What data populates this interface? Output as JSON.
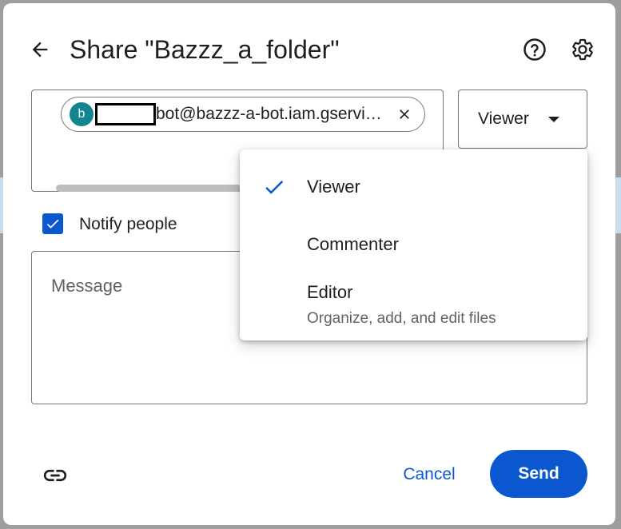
{
  "dialog": {
    "title": "Share \"Bazzz_a_folder\"",
    "icons": {
      "back": "back-arrow-icon",
      "help": "help-icon",
      "settings": "gear-icon",
      "link": "link-icon"
    }
  },
  "recipient": {
    "avatar_letter": "b",
    "email_visible": "bot@bazzz-a-bot.iam.gservi…",
    "remove_icon": "close-icon"
  },
  "role_select": {
    "value": "Viewer"
  },
  "notify": {
    "label": "Notify people",
    "checked": true
  },
  "message": {
    "placeholder": "Message"
  },
  "role_menu": {
    "items": [
      {
        "label": "Viewer",
        "selected": true
      },
      {
        "label": "Commenter",
        "selected": false
      },
      {
        "label": "Editor",
        "description": "Organize, add, and edit files",
        "selected": false
      }
    ]
  },
  "footer": {
    "cancel_label": "Cancel",
    "send_label": "Send"
  },
  "colors": {
    "accent": "#0b57d0",
    "avatar": "#12858f"
  }
}
